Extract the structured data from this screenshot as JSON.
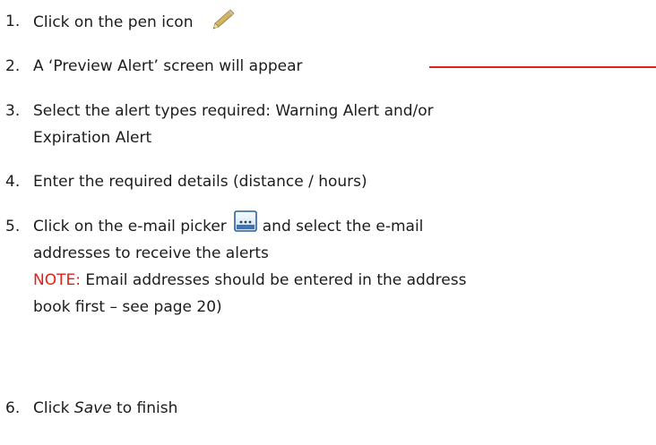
{
  "steps": [
    {
      "num": "1.",
      "text": "Click on the pen  icon"
    },
    {
      "num": "2.",
      "text": "A ‘Preview Alert’ screen will appear"
    },
    {
      "num": "3.",
      "line1": "Select the alert types required: Warning Alert and/or",
      "line2": "Expiration Alert"
    },
    {
      "num": "4.",
      "text": "Enter the required details (distance / hours)"
    },
    {
      "num": "5.",
      "line1_before": "Click on the e-mail picker",
      "line1_after": "and select the e-mail",
      "line2": "addresses to receive the alerts",
      "note_label": "NOTE:",
      "note_text": " Email addresses should be entered in the address",
      "note_line2": "book first – see page 20)"
    },
    {
      "num": "6.",
      "before": "Click ",
      "italic": "Save",
      "after": " to finish"
    }
  ],
  "icons": {
    "pen": "pen-icon",
    "picker": "email-picker-icon"
  },
  "colors": {
    "text": "#1c1c1c",
    "note": "#e1201b",
    "accent_line": "#e1201b"
  }
}
